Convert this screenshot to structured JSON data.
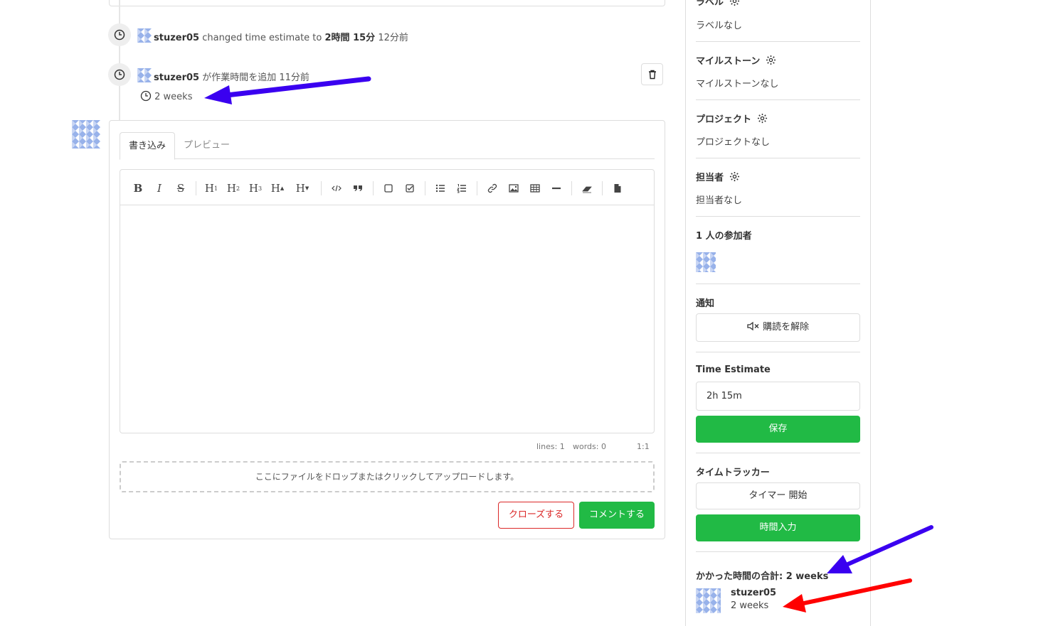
{
  "timeline": {
    "event1": {
      "user": "stuzer05",
      "action": "changed time estimate to",
      "value": "2時間 15分",
      "time": "12分前"
    },
    "event2": {
      "user": "stuzer05",
      "action": "が作業時間を追加",
      "time": "11分前",
      "duration": "2 weeks"
    }
  },
  "comment_form": {
    "tabs": [
      "書き込み",
      "プレビュー"
    ],
    "toolbar": [
      "bold-icon",
      "italic-icon",
      "strikethrough-icon",
      "heading-1-icon",
      "heading-2-icon",
      "heading-3-icon",
      "heading-bigger-icon",
      "heading-smaller-icon",
      "code-icon",
      "quote-icon",
      "checkbox-icon",
      "checkbox-checked-icon",
      "unordered-list-icon",
      "ordered-list-icon",
      "link-icon",
      "image-icon",
      "table-icon",
      "horizontal-rule-icon",
      "eraser-icon",
      "file-icon"
    ],
    "status": {
      "lines": "lines: 1",
      "words": "words: 0",
      "cursor": "1:1"
    },
    "dropzone": "ここにファイルをドロップまたはクリックしてアップロードします。",
    "close_button": "クローズする",
    "comment_button": "コメントする"
  },
  "sidebar": {
    "labels": {
      "title": "ラベル",
      "value": "ラベルなし"
    },
    "milestone": {
      "title": "マイルストーン",
      "value": "マイルストーンなし"
    },
    "projects": {
      "title": "プロジェクト",
      "value": "プロジェクトなし"
    },
    "assignees": {
      "title": "担当者",
      "value": "担当者なし"
    },
    "participants": {
      "title": "1 人の参加者"
    },
    "notifications": {
      "title": "通知",
      "button": "購読を解除"
    },
    "time_estimate": {
      "title": "Time Estimate",
      "value": "2h 15m",
      "save": "保存"
    },
    "time_tracker": {
      "title": "タイムトラッカー",
      "start": "タイマー 開始",
      "manual": "時間入力"
    },
    "total": {
      "label": "かかった時間の合計: 2 weeks",
      "user": "stuzer05",
      "duration": "2 weeks"
    }
  },
  "colors": {
    "green": "#21ba45",
    "red": "#db2828",
    "arrow_blue": "#3a00f0",
    "arrow_red": "#ff0000"
  }
}
